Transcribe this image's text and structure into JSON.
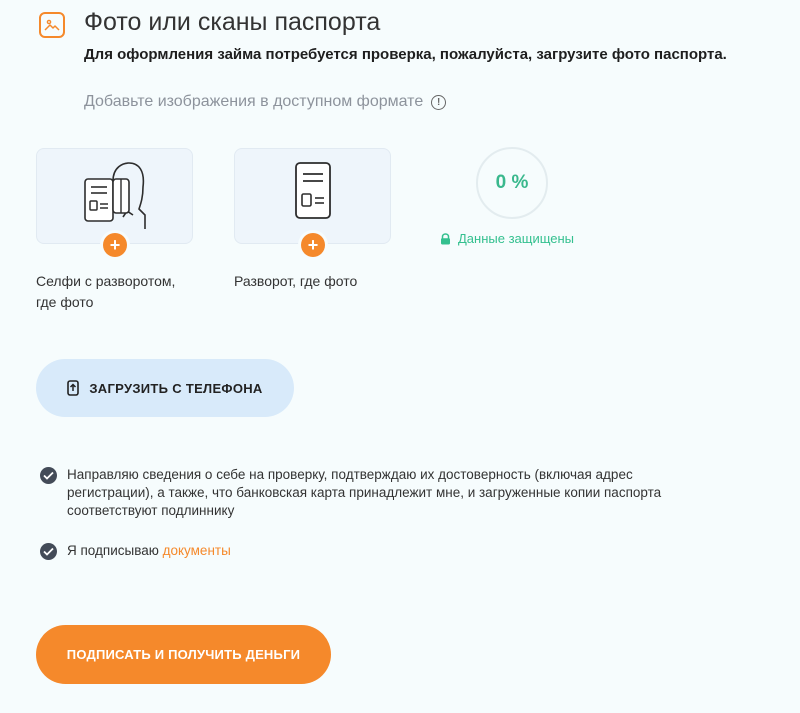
{
  "header": {
    "title": "Фото или сканы паспорта",
    "subtitle": "Для оформления займа потребуется проверка, пожалуйста, загрузите фото паспорта.",
    "hint": "Добавьте изображения в доступном формате"
  },
  "uploads": [
    {
      "label": "Селфи с разворотом, где фото"
    },
    {
      "label": "Разворот, где фото"
    }
  ],
  "progress": {
    "text": "0 %",
    "percent": 0
  },
  "secure_text": "Данные защищены",
  "phone_button": {
    "label": "ЗАГРУЗИТЬ С ТЕЛЕФОНА"
  },
  "consents": [
    {
      "text": "Направляю сведения о себе на проверку, подтверждаю их достоверность (включая адрес регистрации), а также, что банковская карта принадлежит мне, и загруженные копии паспорта соответствуют подлиннику"
    },
    {
      "text": "Я подписываю ",
      "link": "документы"
    }
  ],
  "submit_button": {
    "label": "ПОДПИСАТЬ И ПОЛУЧИТЬ ДЕНЬГИ"
  },
  "colors": {
    "accent": "#f5892b",
    "success": "#34c08f",
    "card_bg": "#eef5fb",
    "phone_btn_bg": "#d8eafa"
  },
  "icons": [
    "image-icon",
    "info-icon",
    "selfie-passport-icon",
    "passport-icon",
    "plus-icon",
    "lock-icon",
    "phone-upload-icon",
    "check-icon"
  ]
}
